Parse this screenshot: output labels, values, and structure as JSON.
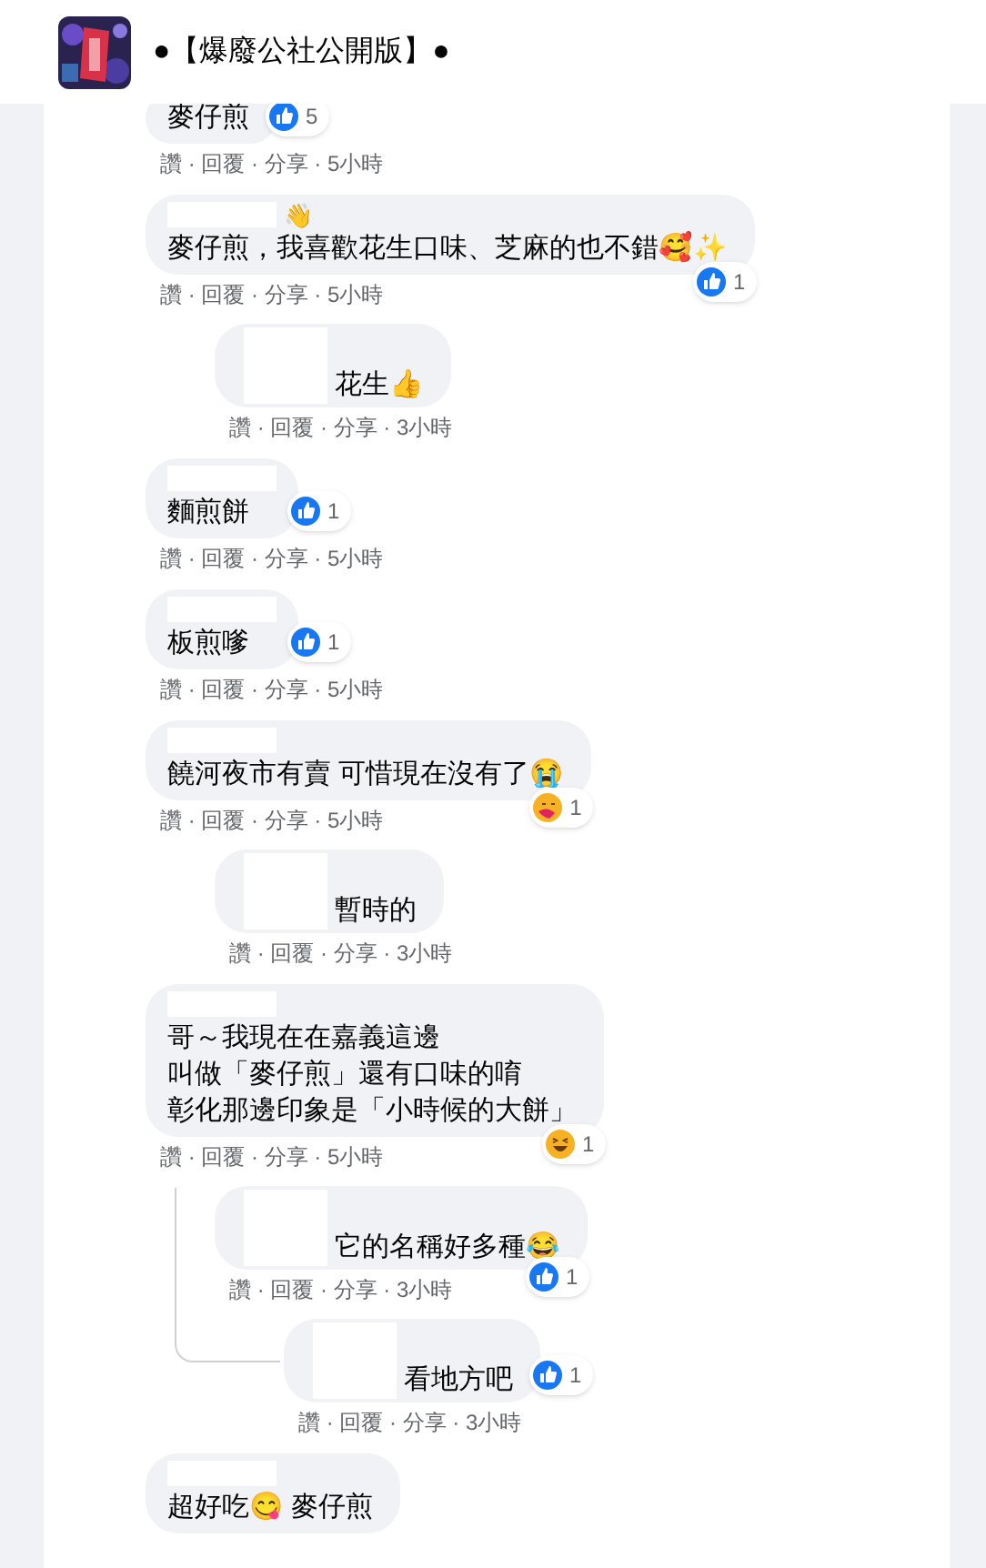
{
  "header": {
    "title": "●【爆廢公社公開版】●"
  },
  "comments": [
    {
      "lines": [
        "麥仔煎"
      ],
      "reaction": {
        "kind": "like",
        "count": "5"
      },
      "meta": "讚 · 回覆 · 分享 · 5小時"
    },
    {
      "lines": [
        "麥仔煎，我喜歡花生口味、芝麻的也不錯🥰✨"
      ],
      "name_badge": "👋",
      "reaction": {
        "kind": "like",
        "count": "1"
      },
      "meta": "讚 · 回覆 · 分享 · 5小時",
      "children": [
        {
          "lines": [
            "花生👍"
          ],
          "meta": "讚 · 回覆 · 分享 · 3小時"
        }
      ]
    },
    {
      "lines": [
        "麵煎餅"
      ],
      "reaction": {
        "kind": "like",
        "count": "1"
      },
      "meta": "讚 · 回覆 · 分享 · 5小時"
    },
    {
      "lines": [
        "板煎嗲"
      ],
      "reaction": {
        "kind": "like",
        "count": "1"
      },
      "meta": "讚 · 回覆 · 分享 · 5小時"
    },
    {
      "lines": [
        "饒河夜市有賣 可惜現在沒有了😭"
      ],
      "reaction": {
        "kind": "care",
        "count": "1"
      },
      "meta": "讚 · 回覆 · 分享 · 5小時",
      "children": [
        {
          "lines": [
            "暫時的"
          ],
          "meta": "讚 · 回覆 · 分享 · 3小時"
        }
      ]
    },
    {
      "lines": [
        "哥～我現在在嘉義這邊",
        "叫做「麥仔煎」還有口味的唷",
        "彰化那邊印象是「小時候的大餅」"
      ],
      "reaction": {
        "kind": "haha",
        "count": "1"
      },
      "meta": "讚 · 回覆 · 分享 · 5小時",
      "children": [
        {
          "lines": [
            "它的名稱好多種😂"
          ],
          "reaction": {
            "kind": "like",
            "count": "1"
          },
          "meta": "讚 · 回覆 · 分享 · 3小時",
          "children": [
            {
              "lines": [
                "看地方吧"
              ],
              "reaction": {
                "kind": "like",
                "count": "1"
              },
              "meta": "讚 · 回覆 · 分享 · 3小時"
            }
          ]
        }
      ]
    },
    {
      "lines": [
        "超好吃😋 麥仔煎"
      ]
    }
  ]
}
